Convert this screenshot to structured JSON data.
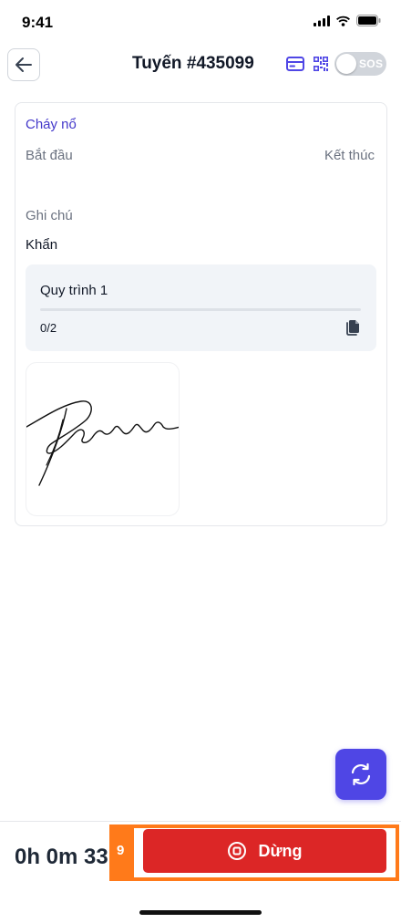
{
  "status_bar": {
    "time": "9:41"
  },
  "header": {
    "title": "Tuyến #435099",
    "sos_label": "SOS",
    "icons": [
      "card-icon",
      "qr-code-icon"
    ]
  },
  "incident": {
    "type": "Cháy nổ",
    "start_label": "Bắt đầu",
    "end_label": "Kết thúc",
    "note_label": "Ghi chú",
    "note_value": "Khẩn"
  },
  "process": {
    "name": "Quy trình 1",
    "count": "0/2",
    "progress": 0
  },
  "footer": {
    "timer": "0h 0m 33",
    "highlight_index": "9",
    "stop_label": "Dừng"
  },
  "colors": {
    "accent": "#4f46e5",
    "danger": "#dc2626",
    "highlight": "#ff7a1a",
    "muted_text": "#6b7280"
  }
}
